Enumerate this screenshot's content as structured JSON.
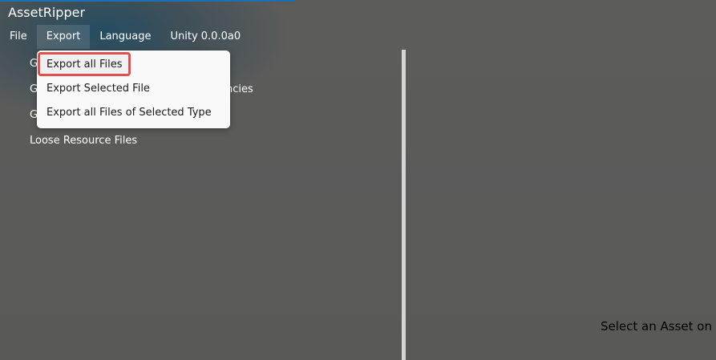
{
  "app": {
    "title": "AssetRipper"
  },
  "menubar": {
    "items": [
      {
        "label": "File"
      },
      {
        "label": "Export"
      },
      {
        "label": "Language"
      },
      {
        "label": "Unity 0.0.0a0"
      }
    ]
  },
  "tree": {
    "items": [
      {
        "label": "G"
      },
      {
        "label": "G"
      },
      {
        "label": "G"
      },
      {
        "label": "Loose Resource Files"
      }
    ],
    "partial_text": "ncies"
  },
  "export_menu": {
    "items": [
      {
        "label": "Export all Files"
      },
      {
        "label": "Export Selected File"
      },
      {
        "label": "Export all Files of Selected Type"
      }
    ]
  },
  "viewer": {
    "placeholder": "Select an Asset on"
  },
  "colors": {
    "background": "#5b5b5a",
    "accent_line": "#1f6fb0",
    "highlight_border": "#e0504d",
    "dropdown_bg": "#f9f9f9",
    "splitter": "#d5d5d5"
  }
}
